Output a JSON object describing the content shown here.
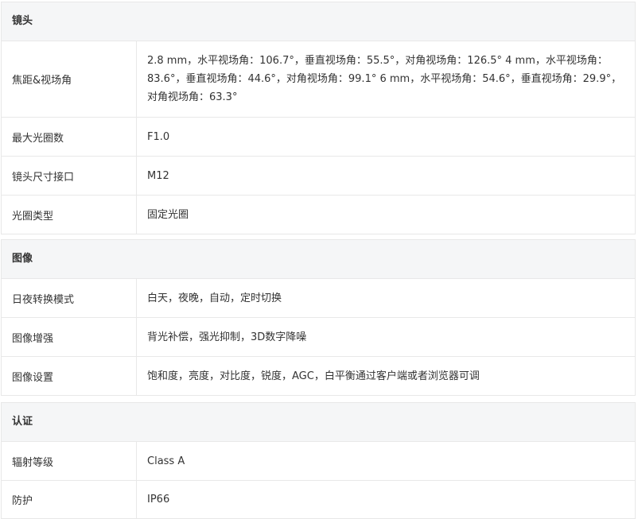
{
  "sections": [
    {
      "title": "镜头",
      "rows": [
        {
          "label": "焦距&视场角",
          "value": "2.8 mm，水平视场角：106.7°，垂直视场角：55.5°，对角视场角：126.5° 4 mm，水平视场角：83.6°，垂直视场角：44.6°，对角视场角：99.1° 6 mm，水平视场角：54.6°，垂直视场角：29.9°，对角视场角：63.3°"
        },
        {
          "label": "最大光圈数",
          "value": "F1.0"
        },
        {
          "label": "镜头尺寸接口",
          "value": "M12"
        },
        {
          "label": "光圈类型",
          "value": "固定光圈"
        }
      ]
    },
    {
      "title": "图像",
      "rows": [
        {
          "label": "日夜转换模式",
          "value": "白天，夜晚，自动，定时切换"
        },
        {
          "label": "图像增强",
          "value": "背光补偿，强光抑制，3D数字降噪"
        },
        {
          "label": "图像设置",
          "value": "饱和度，亮度，对比度，锐度，AGC，白平衡通过客户端或者浏览器可调"
        }
      ]
    },
    {
      "title": "认证",
      "rows": [
        {
          "label": "辐射等级",
          "value": "Class A"
        },
        {
          "label": "防护",
          "value": "IP66"
        }
      ]
    }
  ]
}
